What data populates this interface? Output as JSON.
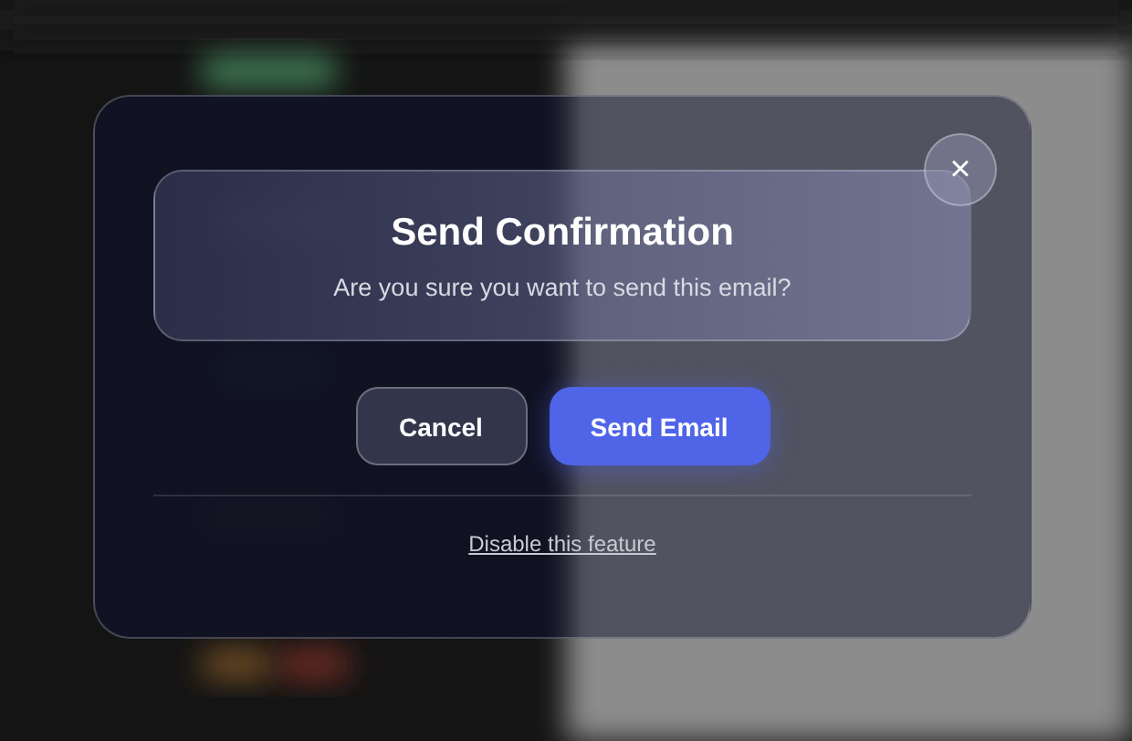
{
  "dialog": {
    "title": "Send Confirmation",
    "message": "Are you sure you want to send this email?",
    "close_button": "×",
    "buttons": [
      {
        "label": "Cancel",
        "kind": "secondary"
      },
      {
        "label": "Send Email",
        "kind": "primary"
      }
    ],
    "link": "Disable this feature"
  }
}
